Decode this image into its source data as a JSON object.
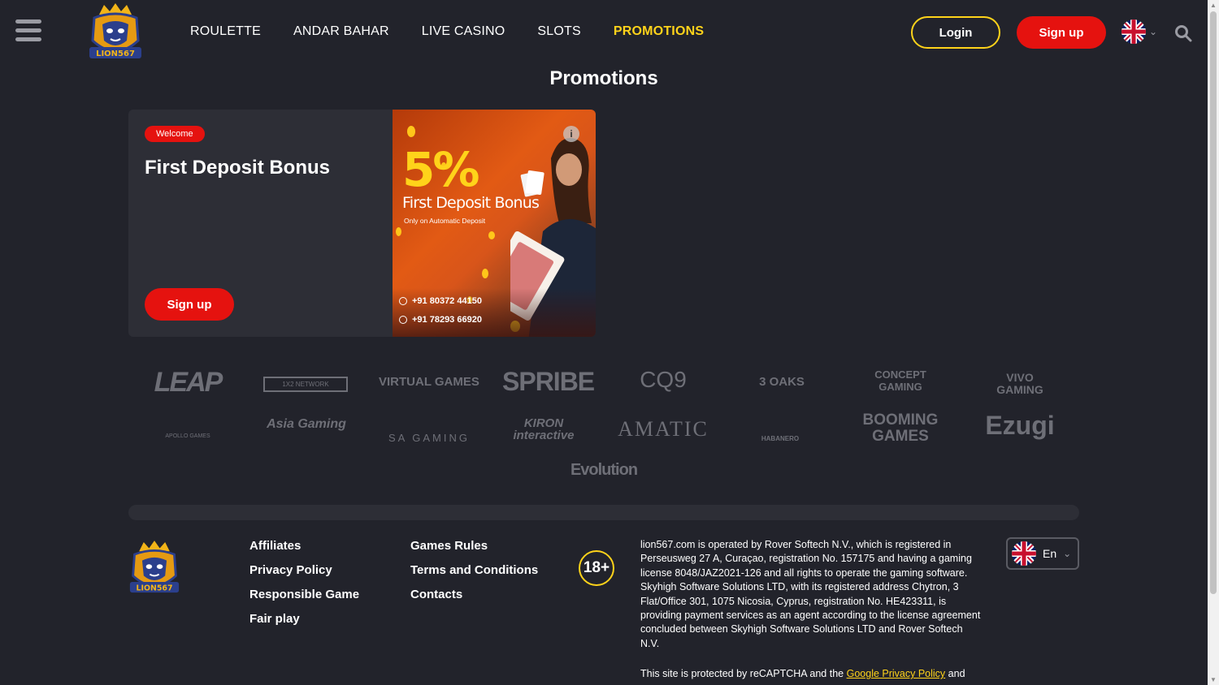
{
  "header": {
    "nav": [
      {
        "label": "ROULETTE",
        "active": false
      },
      {
        "label": "ANDAR BAHAR",
        "active": false
      },
      {
        "label": "LIVE CASINO",
        "active": false
      },
      {
        "label": "SLOTS",
        "active": false
      },
      {
        "label": "PROMOTIONS",
        "active": true
      }
    ],
    "login_label": "Login",
    "signup_label": "Sign up",
    "logo_text": "LION567"
  },
  "page_title": "Promotions",
  "promo": {
    "badge": "Welcome",
    "title": "First Deposit Bonus",
    "button_label": "Sign up",
    "banner": {
      "percent": "5%",
      "title": "First Deposit Bonus",
      "subtitle": "Only on Automatic Deposit",
      "phone_1": "+91 80372 44150",
      "phone_2": "+91 78293 66920"
    }
  },
  "providers": [
    "LEAP",
    "1X2 NETWORK",
    "VIRTUAL GAMES",
    "SPRIBE",
    "CQ9",
    "3 OAKS",
    "CONCEPT GAMING",
    "VIVO GAMING",
    "APOLLO GAMES",
    "Asia Gaming",
    "SA GAMING",
    "KIRON interactive",
    "AMATIC",
    "HABANERO",
    "BOOMING GAMES",
    "Ezugi",
    "Evolution"
  ],
  "footer": {
    "col1": [
      "Affiliates",
      "Privacy Policy",
      "Responsible Game",
      "Fair play"
    ],
    "col2": [
      "Games Rules",
      "Terms and Conditions",
      "Contacts"
    ],
    "age": "18+",
    "legal_text": "lion567.com is operated by Rover Softech N.V., which is registered in Perseusweg 27 A, Curaçao, registration No. 157175 and having a gaming license 8048/JAZ2021-126 and all rights to operate the gaming software. Skyhigh Software Solutions LTD, with its registered address Chytron, 3 Flat/Office 301, 1075 Nicosia, Cyprus, registration No. HE423311, is providing payment services as an agent according to the license agreement concluded between Skyhigh Software Solutions LTD and Rover Softech N.V.",
    "recaptcha_prefix": "This site is protected by reCAPTCHA and the",
    "recaptcha_link": "Google Privacy Policy",
    "recaptcha_suffix": "and",
    "lang_label": "En"
  },
  "colors": {
    "accent": "#ffd31a",
    "primary": "#e5120f",
    "background": "#22232b",
    "card": "#2d2e36"
  }
}
